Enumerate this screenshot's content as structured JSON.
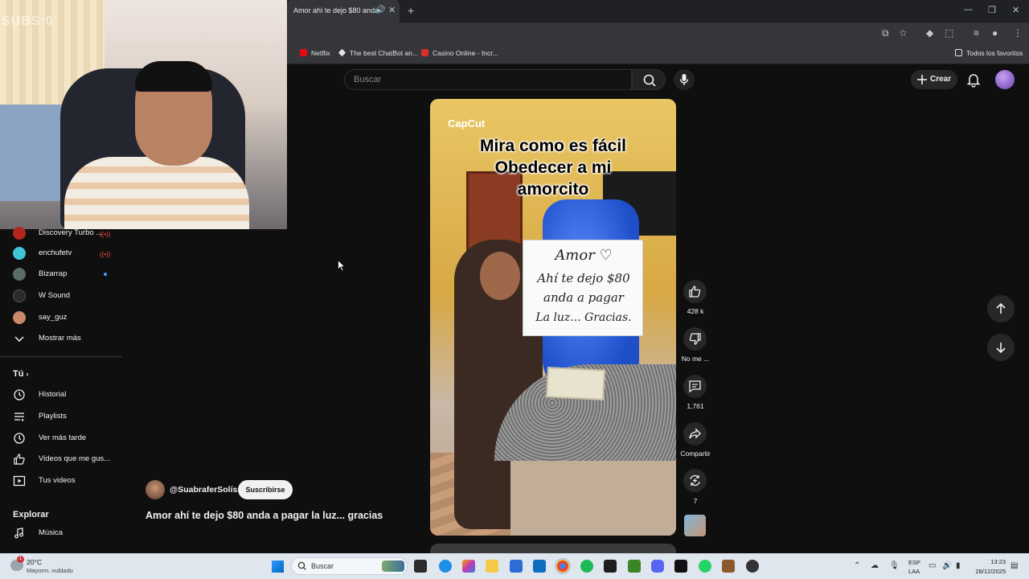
{
  "browser": {
    "tab_title": "Amor ahí te dejo $80 anda",
    "bookmarks": [
      {
        "label": "Netflix",
        "color": "#e50914"
      },
      {
        "label": "The best ChatBot an...",
        "color": "#e3e3e3"
      },
      {
        "label": "Casino Online - Incr...",
        "color": "#d93025"
      }
    ],
    "all_bookmarks_label": "Todos los favoritos"
  },
  "webcam": {
    "watermark": "SUBS:0"
  },
  "header": {
    "search_placeholder": "Buscar",
    "create_label": "Crear"
  },
  "sidebar": {
    "subscriptions": [
      {
        "label": "Discovery Turbo ...",
        "status": "live"
      },
      {
        "label": "enchufetv",
        "status": "live"
      },
      {
        "label": "Bizarrap",
        "status": "new"
      },
      {
        "label": "W Sound",
        "status": ""
      },
      {
        "label": "say_guz",
        "status": ""
      }
    ],
    "show_more": "Mostrar más",
    "you_heading": "Tú",
    "you_items": [
      {
        "label": "Historial",
        "icon": "history-icon"
      },
      {
        "label": "Playlists",
        "icon": "playlists-icon"
      },
      {
        "label": "Ver más tarde",
        "icon": "watch-later-icon"
      },
      {
        "label": "Videos que me gus...",
        "icon": "liked-videos-icon"
      },
      {
        "label": "Tus videos",
        "icon": "your-videos-icon"
      }
    ],
    "explore_heading": "Explorar",
    "explore_items": [
      {
        "label": "Música",
        "icon": "music-icon"
      }
    ]
  },
  "video": {
    "capcut_label": "CapCut",
    "caption_lines": [
      "Mira como es fácil",
      "Obedecer a mi",
      "amorcito"
    ],
    "sign_lines": [
      "Amor ♡",
      "Ahí te dejo $80",
      "anda a pagar",
      "La luz... Gracias."
    ]
  },
  "actions": {
    "likes": "428 k",
    "dislike_label": "No me ...",
    "comments": "1,761",
    "share_label": "Compartir",
    "remix_count": "7"
  },
  "channel": {
    "handle": "@SuabraferSolís",
    "subscribe_label": "Suscribirse",
    "short_title": "Amor ahí te dejo $80 anda a pagar la luz... gracias"
  },
  "taskbar": {
    "weather_temp": "20°C",
    "weather_desc": "Mayorm. nublado",
    "weather_badge": "1",
    "search_label": "Buscar",
    "lang_top": "ESP",
    "lang_bottom": "LAA",
    "time": "13:23",
    "date": "28/12/2025"
  },
  "colors": {
    "yt_background": "#0f0f0f",
    "live_red": "#ff4e45",
    "new_dot_blue": "#3ea6ff"
  }
}
